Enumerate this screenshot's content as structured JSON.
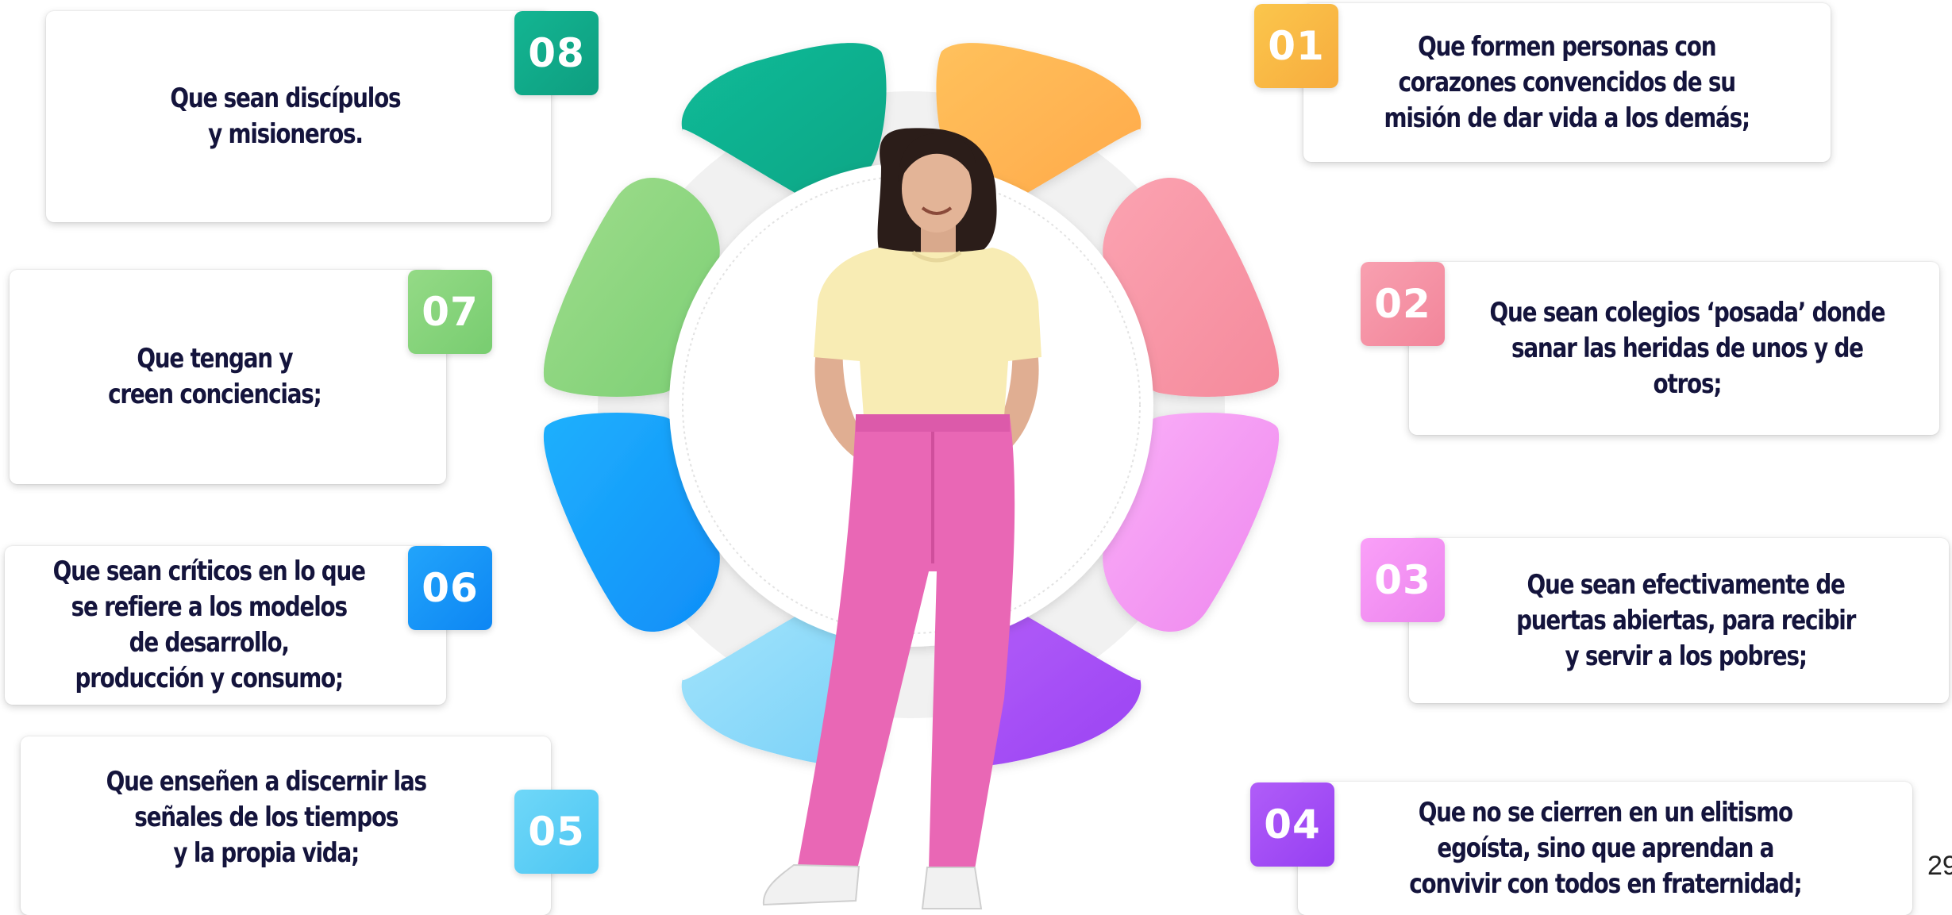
{
  "items": [
    {
      "number": "01",
      "text": "Que formen personas con\ncorazones convencidos de su\nmisión de dar vida a los demás;",
      "color": "#fbbf46"
    },
    {
      "number": "02",
      "text": "Que sean colegios ‘posada’ donde\nsanar las heridas de unos y de otros;",
      "color": "#f690a3"
    },
    {
      "number": "03",
      "text": "Que sean efectivamente de\npuertas abiertas, para recibir\ny servir a los pobres;",
      "color": "#f48ef4"
    },
    {
      "number": "04",
      "text": "Que no se cierren en un elitismo\negoísta, sino que aprendan a\nconvivir con todos en fraternidad;",
      "color": "#a24ff4"
    },
    {
      "number": "05",
      "text": "Que enseñen a discernir las\nseñales de los tiempos\ny la propia vida;",
      "color": "#5fd0f6"
    },
    {
      "number": "06",
      "text": "Que sean críticos en lo que\nse refiere a los modelos\nde desarrollo,\nproducción y consumo;",
      "color": "#1a8ff5"
    },
    {
      "number": "07",
      "text": "Que tengan y\ncreen conciencias;",
      "color": "#82d47c"
    },
    {
      "number": "08",
      "text": "Que sean discípulos\ny misioneros.",
      "color": "#12a987"
    }
  ],
  "page_number": "29",
  "colors": {
    "text": "#14143c",
    "petal_01": "#ffb454",
    "petal_02": "#f99aaa",
    "petal_03": "#f8a0f6",
    "petal_04": "#a44ff6",
    "petal_05": "#8fdcfa",
    "petal_06": "#14a0fb",
    "petal_07": "#8dd77f",
    "petal_08": "#13b290",
    "shirt": "#f8ecb4",
    "pants": "#e967b5"
  }
}
